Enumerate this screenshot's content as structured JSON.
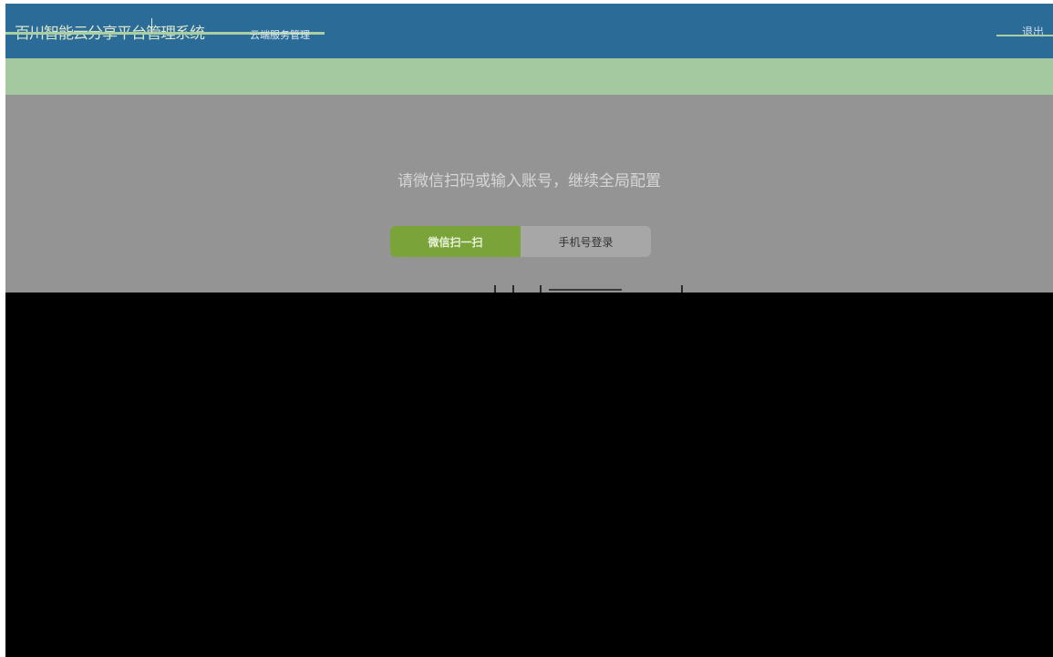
{
  "header": {
    "brand": "百川智能云分享平台管理系统",
    "subtitle": "云端服务管理",
    "exit_label": "退出"
  },
  "login": {
    "prompt": "请微信扫码或输入账号，继续全局配置",
    "tabs": [
      {
        "label": "微信扫一扫",
        "active": true
      },
      {
        "label": "手机号登录",
        "active": false
      }
    ]
  },
  "colors": {
    "header_bg": "#2b6b98",
    "notice_band": "#a4c9a1",
    "panel_bg": "#949494",
    "active_tab": "#7aa43a",
    "inactive_tab": "#a7a7a7",
    "overlay": "#000000"
  }
}
